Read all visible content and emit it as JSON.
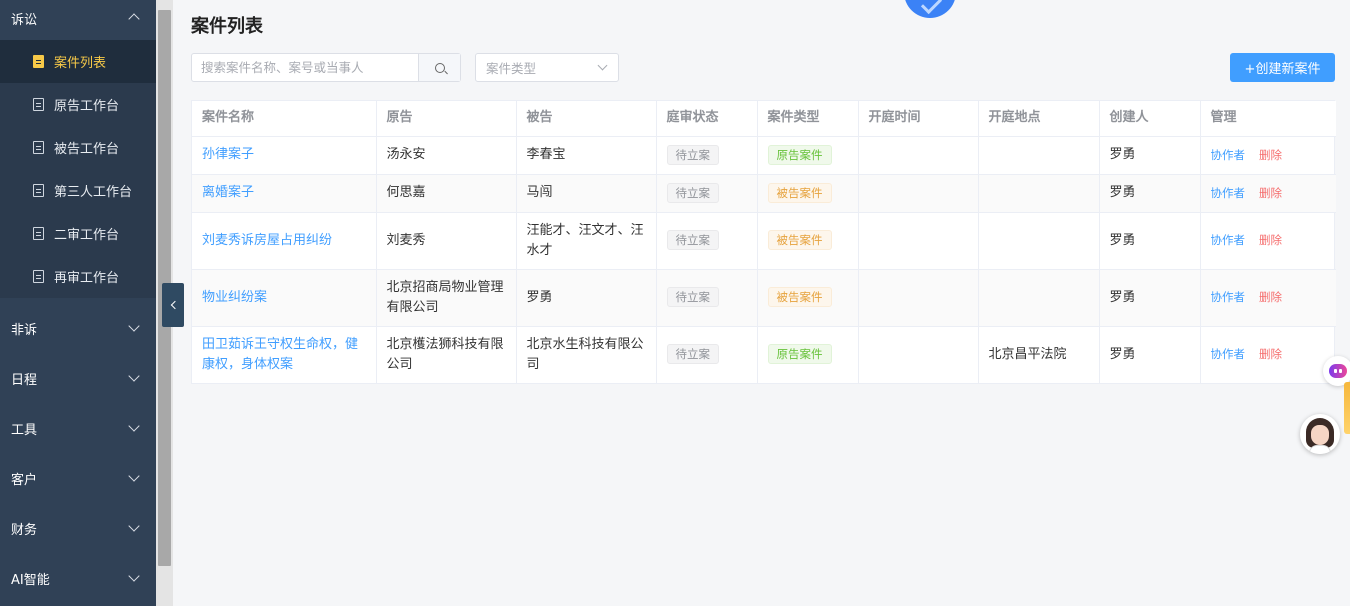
{
  "sidebar": {
    "group_litigation": "诉讼",
    "sub_items": [
      {
        "label": "案件列表",
        "active": true
      },
      {
        "label": "原告工作台"
      },
      {
        "label": "被告工作台"
      },
      {
        "label": "第三人工作台"
      },
      {
        "label": "二审工作台"
      },
      {
        "label": "再审工作台"
      }
    ],
    "groups": [
      "非诉",
      "日程",
      "工具",
      "客户",
      "财务",
      "AI智能"
    ]
  },
  "page": {
    "title": "案件列表",
    "search_placeholder": "搜索案件名称、案号或当事人",
    "type_select_placeholder": "案件类型",
    "create_button": "+创建新案件"
  },
  "table": {
    "headers": [
      "案件名称",
      "原告",
      "被告",
      "庭审状态",
      "案件类型",
      "开庭时间",
      "开庭地点",
      "创建人",
      "管理"
    ],
    "rows": [
      {
        "name": "孙律案子",
        "plaintiff": "汤永安",
        "defendant": "李春宝",
        "status": "待立案",
        "type": "原告案件",
        "time": "",
        "place": "",
        "creator": "罗勇"
      },
      {
        "name": "离婚案子",
        "plaintiff": "何思嘉",
        "defendant": "马闯",
        "status": "待立案",
        "type": "被告案件",
        "time": "",
        "place": "",
        "creator": "罗勇"
      },
      {
        "name": "刘麦秀诉房屋占用纠纷",
        "plaintiff": "刘麦秀",
        "defendant": "汪能才、汪文才、汪水才",
        "status": "待立案",
        "type": "被告案件",
        "time": "",
        "place": "",
        "creator": "罗勇"
      },
      {
        "name": "物业纠纷案",
        "plaintiff": "北京招商局物业管理有限公司",
        "defendant": "罗勇",
        "status": "待立案",
        "type": "被告案件",
        "time": "",
        "place": "",
        "creator": "罗勇"
      },
      {
        "name": "田卫茹诉王守权生命权，健康权，身体权案",
        "plaintiff": "北京檴法狮科技有限公司",
        "defendant": "北京水生科技有限公司",
        "status": "待立案",
        "type": "原告案件",
        "time": "",
        "place": "北京昌平法院",
        "creator": "罗勇"
      }
    ],
    "actions": {
      "collaborator": "协作者",
      "delete": "删除"
    }
  },
  "colors": {
    "sidebar_bg": "#304156",
    "active_item": "#f7c948",
    "primary": "#409eff",
    "danger": "#f56c6c",
    "tag_plaintiff": "#67c23a",
    "tag_defendant": "#e6a23c"
  }
}
